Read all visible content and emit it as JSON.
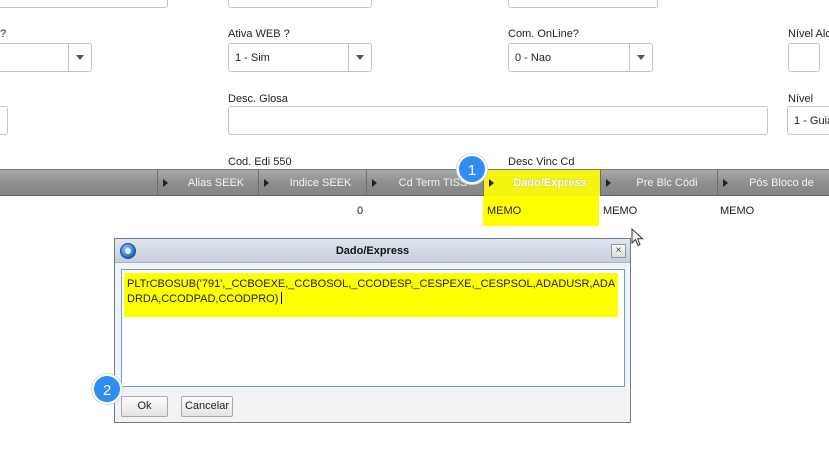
{
  "form": {
    "row1_label_left": "?",
    "ativa_web": {
      "label": "Ativa WEB ?",
      "value": "1 - Sim"
    },
    "com_online": {
      "label": "Com. OnLine?",
      "value": "0 - Nao"
    },
    "nivel_alc": {
      "label": "Nível Alc"
    },
    "desc_glosa": {
      "label": "Desc. Glosa",
      "value": ""
    },
    "nivel": {
      "label": "Nível",
      "value": "1 - Guia"
    },
    "cod_edi": {
      "label": "Cod. Edi 550"
    },
    "desc_vinc": {
      "label": "Desc Vinc Cd"
    }
  },
  "grid": {
    "columns": [
      {
        "label": "Alias SEEK"
      },
      {
        "label": "Indice SEEK"
      },
      {
        "label": "Cd Term TISS"
      },
      {
        "label": "Dado/Express"
      },
      {
        "label": "Pre Blc Códi"
      },
      {
        "label": "Pós Bloco de"
      }
    ],
    "row": [
      "0",
      "MEMO",
      "MEMO",
      "MEMO"
    ]
  },
  "badges": [
    "1",
    "2"
  ],
  "dialog": {
    "title": "Dado/Express",
    "close": "×",
    "content": "PLTrCBOSUB('791',_CCBOEXE,_CCBOSOL,_CCODESP,_CESPEXE,_CESPSOL,ADADUSR,ADADRDA,CCODPAD,CCODPRO)",
    "ok": "Ok",
    "cancel": "Cancelar"
  },
  "colors": {
    "highlight": "#ffff00",
    "badge": "#2f8df2",
    "grid_header": "#8f8f8f"
  }
}
